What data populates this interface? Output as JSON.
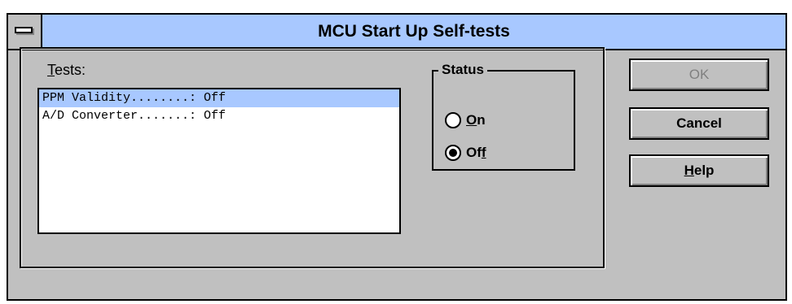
{
  "window": {
    "title": "MCU Start Up Self-tests"
  },
  "tests": {
    "label_accel": "T",
    "label_rest": "ests:",
    "items": [
      {
        "text": "PPM Validity........: Off",
        "selected": true
      },
      {
        "text": "A/D Converter.......: Off",
        "selected": false
      }
    ]
  },
  "status": {
    "legend": "Status",
    "options": [
      {
        "pre": "",
        "accel": "O",
        "post": "n",
        "checked": false
      },
      {
        "pre": "Of",
        "accel": "f",
        "post": "",
        "checked": true
      }
    ]
  },
  "buttons": {
    "ok": {
      "pre": "",
      "accel": "",
      "post": "OK",
      "enabled": false
    },
    "cancel": {
      "pre": "",
      "accel": "",
      "post": "Cancel",
      "enabled": true
    },
    "help": {
      "pre": "",
      "accel": "H",
      "post": "elp",
      "enabled": true
    }
  },
  "colors": {
    "titlebar": "#a8c8ff",
    "selection": "#a8c8ff",
    "face": "#c0c0c0"
  }
}
